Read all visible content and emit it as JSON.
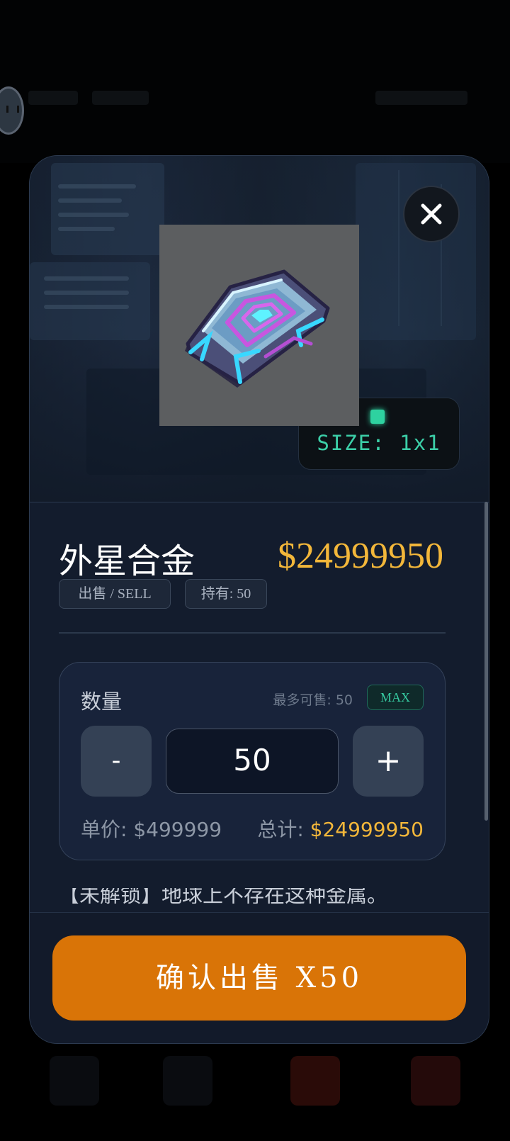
{
  "item": {
    "name": "外星合金",
    "price": "$24999950",
    "size_label": "SIZE: 1x1",
    "description": "【未解锁】地球上不存在这种金属。"
  },
  "chips": {
    "sell": "出售 / SELL",
    "held": "持有: 50"
  },
  "quantity": {
    "label": "数量",
    "max_sellable": "最多可售: 50",
    "max_button": "MAX",
    "minus": "-",
    "plus": "+",
    "value": "50",
    "unit_price": "单价: $499999",
    "total_label": "总计: ",
    "total_value": "$24999950"
  },
  "actions": {
    "confirm": "确认出售 X50",
    "close_icon": "close-icon"
  },
  "colors": {
    "accent_price": "#f3b73a",
    "confirm_button": "#d97407",
    "size_tag_text": "#3ccfa8",
    "modal_bg": "#131c2d"
  }
}
